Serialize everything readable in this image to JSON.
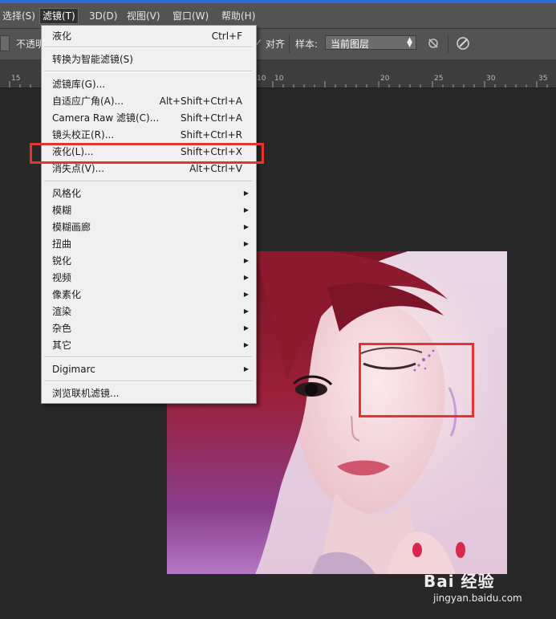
{
  "menu_bar": {
    "items": [
      {
        "label": "选择(S)"
      },
      {
        "label": "滤镜(T)"
      },
      {
        "label": "3D(D)"
      },
      {
        "label": "视图(V)"
      },
      {
        "label": "窗口(W)"
      },
      {
        "label": "帮助(H)"
      }
    ]
  },
  "options_bar": {
    "opacity_label": "不透明",
    "align_label": "对齐",
    "sample_label": "样本:",
    "sample_value": "当前图层"
  },
  "ruler": {
    "ticks": [
      "15",
      "10",
      "10",
      "20",
      "25",
      "30",
      "35"
    ]
  },
  "filter_menu": {
    "items": [
      {
        "label": "液化",
        "shortcut": "Ctrl+F"
      },
      {
        "label": "转换为智能滤镜(S)",
        "shortcut": ""
      },
      {
        "label": "滤镜库(G)...",
        "shortcut": ""
      },
      {
        "label": "自适应广角(A)...",
        "shortcut": "Alt+Shift+Ctrl+A"
      },
      {
        "label": "Camera Raw 滤镜(C)...",
        "shortcut": "Shift+Ctrl+A"
      },
      {
        "label": "镜头校正(R)...",
        "shortcut": "Shift+Ctrl+R"
      },
      {
        "label": "液化(L)...",
        "shortcut": "Shift+Ctrl+X"
      },
      {
        "label": "消失点(V)...",
        "shortcut": "Alt+Ctrl+V"
      },
      {
        "label": "风格化",
        "shortcut": ""
      },
      {
        "label": "模糊",
        "shortcut": ""
      },
      {
        "label": "模糊画廊",
        "shortcut": ""
      },
      {
        "label": "扭曲",
        "shortcut": ""
      },
      {
        "label": "锐化",
        "shortcut": ""
      },
      {
        "label": "视频",
        "shortcut": ""
      },
      {
        "label": "像素化",
        "shortcut": ""
      },
      {
        "label": "渲染",
        "shortcut": ""
      },
      {
        "label": "杂色",
        "shortcut": ""
      },
      {
        "label": "其它",
        "shortcut": ""
      },
      {
        "label": "Digimarc",
        "shortcut": ""
      },
      {
        "label": "浏览联机滤镜...",
        "shortcut": ""
      }
    ]
  },
  "icons": {
    "submenu": "chevron-right-icon",
    "dropdown": "chevron-updown-icon",
    "ignore_adjust": "ignore-adjustment-icon",
    "pressure": "brush-pressure-icon"
  },
  "colors": {
    "highlight_box": "#e5342d",
    "menubar": "#535353",
    "menu_bg": "#f0f0f0"
  },
  "watermark": {
    "brand": "Bai 经验",
    "url": "jingyan.baidu.com"
  }
}
